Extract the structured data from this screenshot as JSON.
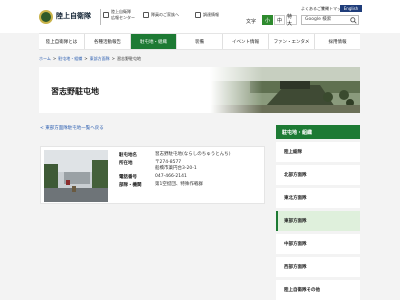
{
  "header": {
    "logo_text": "陸上自衛隊",
    "pr_center": "陸上自衛隊\n広報センター",
    "recruit": "隊員のご家族へ",
    "procurement": "調達情報",
    "sitemap": "よくあるご質問",
    "contact": "サイトマップ",
    "english_label": "English",
    "font_size_label": "文字",
    "font_small": "小",
    "font_medium": "中",
    "font_large": "特大",
    "search_placeholder": "Google 検索"
  },
  "nav": {
    "items": [
      "陸上自衛隊とは",
      "各種活動報告",
      "駐屯地・組織",
      "装備",
      "イベント情報",
      "ファン・エンタメ",
      "採用情報"
    ],
    "active_index": 2
  },
  "breadcrumb": {
    "items": [
      "ホーム",
      "駐屯地・組織",
      "東部方面隊",
      "習志野駐屯地"
    ],
    "separator": ">"
  },
  "banner": {
    "title": "習志野駐屯地"
  },
  "main": {
    "back_link": "< 東部方面隊駐屯地一覧へ戻る",
    "rows": [
      {
        "label": "駐屯地名",
        "value": "習志野駐屯地(ならしのちゅうとんち)"
      },
      {
        "label": "所在地",
        "value": "〒274-8577\n船橋市薬円台3-20-1"
      },
      {
        "label": "電話番号",
        "value": "047-466-2141"
      },
      {
        "label": "部隊・機関",
        "value": "第1空挺団、特殊作戦群"
      }
    ]
  },
  "sidebar": {
    "heading": "駐屯地・組織",
    "items": [
      "陸上総隊",
      "北部方面隊",
      "東北方面隊",
      "東部方面隊",
      "中部方面隊",
      "西部方面隊",
      "陸上自衛隊その他"
    ],
    "active_index": 3
  },
  "colors": {
    "accent_green": "#1d7a34",
    "link_blue": "#2a5db0",
    "english_btn": "#1f3d7a"
  }
}
